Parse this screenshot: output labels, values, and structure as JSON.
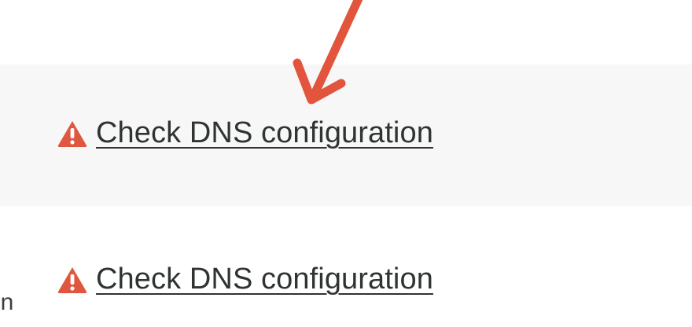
{
  "rows": [
    {
      "label": "Check DNS configuration",
      "icon": "warning-icon"
    },
    {
      "label": "Check DNS configuration",
      "icon": "warning-icon"
    }
  ],
  "edge_text": "in",
  "colors": {
    "warning": "#e0573f",
    "arrow": "#e2553c",
    "link_text": "#2f3433",
    "band": "#f7f7f7"
  },
  "annotation": {
    "icon": "arrow-icon"
  }
}
